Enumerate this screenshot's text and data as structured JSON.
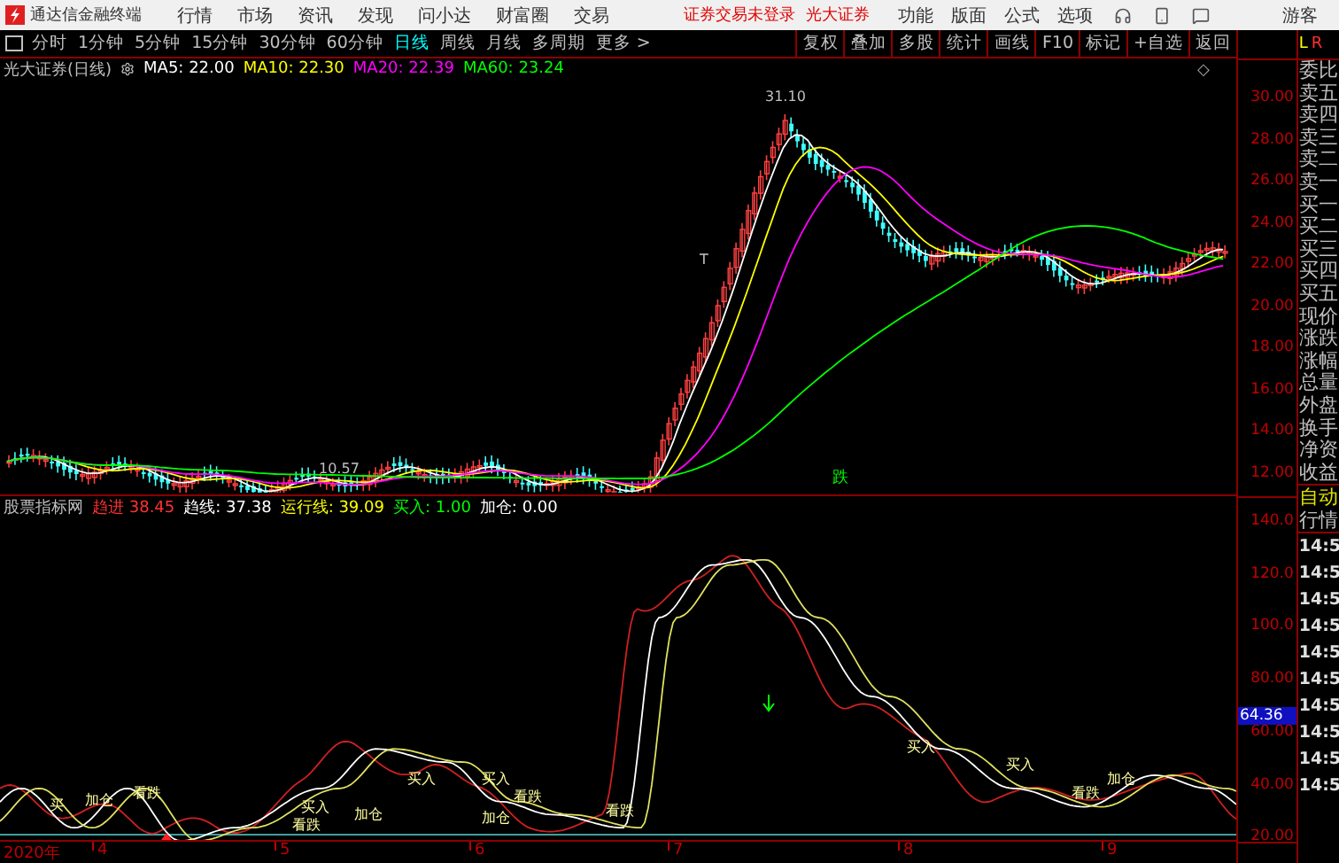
{
  "menu_bar": {
    "app_title": "通达信金融终端",
    "menus": [
      "行情",
      "市场",
      "资讯",
      "发现",
      "问小达",
      "财富圈",
      "交易"
    ],
    "login_status": "证券交易未登录",
    "broker": "光大证券",
    "right_menus": [
      "功能",
      "版面",
      "公式",
      "选项"
    ],
    "user": "游客"
  },
  "period_tabs": [
    {
      "label": "分时",
      "selected": false
    },
    {
      "label": "1分钟",
      "selected": false
    },
    {
      "label": "5分钟",
      "selected": false
    },
    {
      "label": "15分钟",
      "selected": false
    },
    {
      "label": "30分钟",
      "selected": false
    },
    {
      "label": "60分钟",
      "selected": false
    },
    {
      "label": "日线",
      "selected": true
    },
    {
      "label": "周线",
      "selected": false
    },
    {
      "label": "月线",
      "selected": false
    },
    {
      "label": "多周期",
      "selected": false
    },
    {
      "label": "更多 >",
      "selected": false
    }
  ],
  "tools": [
    "复权",
    "叠加",
    "多股",
    "统计",
    "画线",
    "F10",
    "标记",
    "+自选",
    "返回"
  ],
  "lr": {
    "left": "L",
    "right": "R"
  },
  "main_chart": {
    "title": "光大证券(日线)",
    "ma": [
      {
        "label": "MA5: 22.00",
        "color": "#ffffff"
      },
      {
        "label": "MA10: 22.30",
        "color": "#ffff00"
      },
      {
        "label": "MA20: 22.39",
        "color": "#ff00ff"
      },
      {
        "label": "MA60: 23.24",
        "color": "#00ff00"
      }
    ],
    "diamond_glyph": "◇",
    "high_label": "31.10",
    "low_label": "10.57",
    "marker": "T",
    "signal": "跌",
    "price_ticks": [
      "30.00",
      "28.00",
      "26.00",
      "24.00",
      "22.00",
      "20.00",
      "18.00",
      "16.00",
      "14.00",
      "12.00"
    ]
  },
  "indicator": {
    "title": "股票指标网",
    "values": [
      {
        "label": "趋进 38.45",
        "color": "#ff3030"
      },
      {
        "label": "趋线: 37.38",
        "color": "#ffffff"
      },
      {
        "label": "运行线: 39.09",
        "color": "#ffff00"
      },
      {
        "label": "买入: 1.00",
        "color": "#00ff00"
      },
      {
        "label": "加仓: 0.00",
        "color": "#ffffff"
      }
    ],
    "ticks": [
      "140.0",
      "120.0",
      "100.0",
      "80.00",
      "60.00",
      "40.00",
      "20.00"
    ],
    "current_value": "64.36",
    "signals": [
      "买",
      "加仓",
      "看跌",
      "买入",
      "看跌",
      "加仓",
      "买入",
      "买入",
      "看跌",
      "加仓",
      "看跌",
      "买入",
      "买入",
      "看跌",
      "加仓"
    ]
  },
  "date_axis": [
    "2020年",
    "4",
    "5",
    "6",
    "7",
    "8",
    "9"
  ],
  "quote_panel": {
    "labels": [
      "委比",
      "卖五",
      "卖四",
      "卖三",
      "卖二",
      "卖一",
      "买一",
      "买二",
      "买三",
      "买四",
      "买五",
      "现价",
      "涨跌",
      "涨幅",
      "总量",
      "外盘",
      "换手",
      "净资",
      "收益"
    ],
    "mode": [
      "自动",
      "行情"
    ],
    "times": [
      "14:5",
      "14:5",
      "14:5",
      "14:5",
      "14:5",
      "14:5",
      "14:5",
      "14:5",
      "14:5",
      "14:5"
    ]
  }
}
